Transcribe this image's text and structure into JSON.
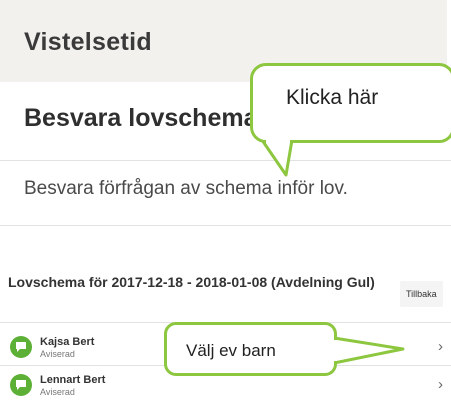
{
  "page": {
    "title": "Vistelsetid"
  },
  "section": {
    "title": "Besvara lovschema",
    "description": "Besvara förfrågan av schema inför lov."
  },
  "schema": {
    "heading": "Lovschema för 2017-12-18 - 2018-01-08 (Avdelning Gul)",
    "back_label": "Tillbaka",
    "children": [
      {
        "name": "Kajsa Bert",
        "status": "Aviserad"
      },
      {
        "name": "Lennart Bert",
        "status": "Aviserad"
      }
    ]
  },
  "callouts": {
    "click_here": "Klicka här",
    "choose_child": "Välj ev barn"
  },
  "colors": {
    "accent_green": "#8dc63f",
    "avatar_green": "#5cb035",
    "header_band": "#f2f1ee"
  },
  "icons": {
    "avatar": "chat-bubble-icon",
    "row_action": "chevron-right-icon"
  }
}
